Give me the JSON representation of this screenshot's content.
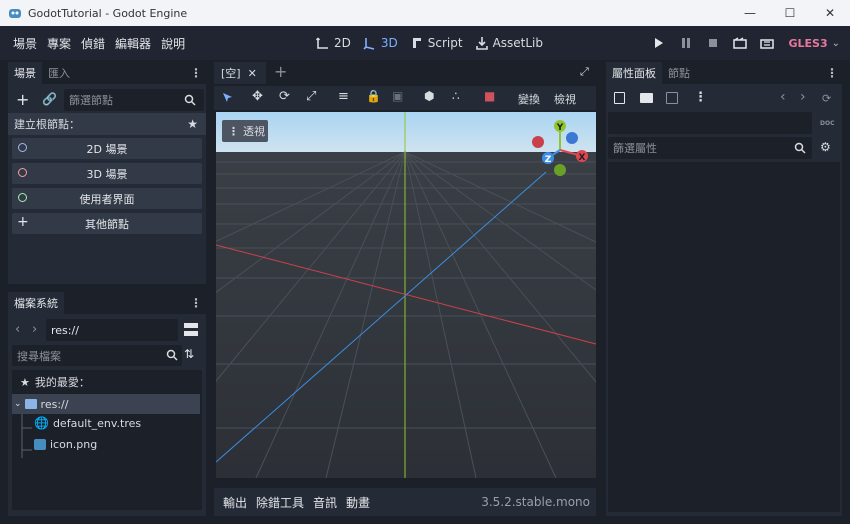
{
  "window": {
    "title": "GodotTutorial - Godot Engine"
  },
  "menu": {
    "items": [
      "場景",
      "專案",
      "偵錯",
      "編輯器",
      "說明"
    ]
  },
  "modes": {
    "2d": "2D",
    "3d": "3D",
    "script": "Script",
    "assetlib": "AssetLib"
  },
  "renderer": "GLES3",
  "scene_dock": {
    "tab_scene": "場景",
    "tab_import": "匯入",
    "filter_placeholder": "篩選節點",
    "create_root": "建立根節點：",
    "buttons": [
      "2D 場景",
      "3D 場景",
      "使用者界面",
      "其他節點"
    ]
  },
  "fs_dock": {
    "tab": "檔案系統",
    "path": "res://",
    "search_placeholder": "搜尋檔案",
    "favorites": "我的最愛：",
    "root": "res://",
    "files": [
      "default_env.tres",
      "icon.png"
    ]
  },
  "editor": {
    "tab": "[空]",
    "transform": "變換",
    "view": "檢視",
    "perspective": "透視"
  },
  "bottom": {
    "output": "輸出",
    "debugger": "除錯工具",
    "audio": "音訊",
    "animation": "動畫",
    "version": "3.5.2.stable.mono"
  },
  "inspector": {
    "tab_inspector": "屬性面板",
    "tab_node": "節點",
    "filter_placeholder": "篩選屬性",
    "doc": "DOC"
  },
  "gizmo": {
    "x": "X",
    "y": "Y",
    "z": "Z"
  },
  "colors": {
    "accent": "#7fb0ff",
    "gles": "#e8789c",
    "x_axis": "#e0464f",
    "y_axis": "#8fc62c",
    "z_axis": "#3b8fe6"
  }
}
